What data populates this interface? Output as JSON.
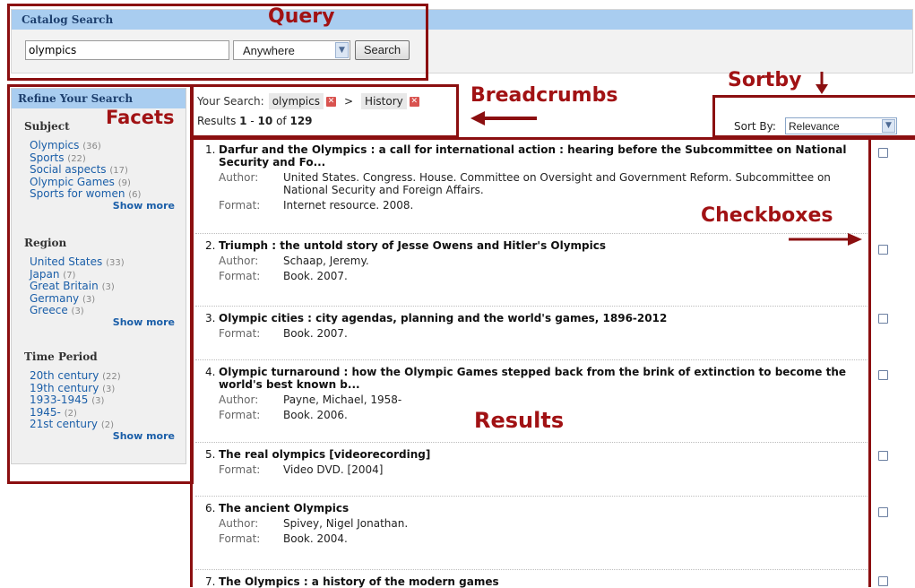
{
  "search": {
    "title": "Catalog Search",
    "query": "olympics",
    "scope": "Anywhere",
    "button": "Search"
  },
  "facets": {
    "title": "Refine Your Search",
    "groups": [
      {
        "heading": "Subject",
        "items": [
          {
            "label": "Olympics",
            "count": "(36)"
          },
          {
            "label": "Sports",
            "count": "(22)"
          },
          {
            "label": "Social aspects",
            "count": "(17)"
          },
          {
            "label": "Olympic Games",
            "count": "(9)"
          },
          {
            "label": "Sports for women",
            "count": "(6)"
          }
        ],
        "show_more": "Show more"
      },
      {
        "heading": "Region",
        "items": [
          {
            "label": "United States",
            "count": "(33)"
          },
          {
            "label": "Japan",
            "count": "(7)"
          },
          {
            "label": "Great Britain",
            "count": "(3)"
          },
          {
            "label": "Germany",
            "count": "(3)"
          },
          {
            "label": "Greece",
            "count": "(3)"
          }
        ],
        "show_more": "Show more"
      },
      {
        "heading": "Time Period",
        "items": [
          {
            "label": "20th century",
            "count": "(22)"
          },
          {
            "label": "19th century",
            "count": "(3)"
          },
          {
            "label": "1933-1945",
            "count": "(3)"
          },
          {
            "label": "1945-",
            "count": "(2)"
          },
          {
            "label": "21st century",
            "count": "(2)"
          }
        ],
        "show_more": "Show more"
      }
    ]
  },
  "breadcrumbs": {
    "label": "Your Search:",
    "crumbs": [
      "olympics",
      "History"
    ],
    "separator": ">",
    "results_prefix": "Results",
    "range_start": "1",
    "range_dash": "-",
    "range_end": "10",
    "of_text": "of",
    "total": "129"
  },
  "sort": {
    "label": "Sort By:",
    "value": "Relevance"
  },
  "results": [
    {
      "num": "1.",
      "title": "Darfur and the Olympics : a call for international action : hearing before the Subcommittee on National Security and Fo...",
      "fields": [
        {
          "label": "Author:",
          "value": "United States. Congress. House. Committee on Oversight and Government Reform. Subcommittee on National Security and Foreign Affairs."
        },
        {
          "label": "Format:",
          "value": "Internet resource. 2008."
        }
      ]
    },
    {
      "num": "2.",
      "title": "Triumph : the untold story of Jesse Owens and Hitler's Olympics",
      "fields": [
        {
          "label": "Author:",
          "value": "Schaap, Jeremy."
        },
        {
          "label": "Format:",
          "value": "Book. 2007."
        }
      ]
    },
    {
      "num": "3.",
      "title": "Olympic cities : city agendas, planning and the world's games, 1896-2012",
      "fields": [
        {
          "label": "Format:",
          "value": "Book. 2007."
        }
      ]
    },
    {
      "num": "4.",
      "title": "Olympic turnaround : how the Olympic Games stepped back from the brink of extinction to become the world's best known b...",
      "fields": [
        {
          "label": "Author:",
          "value": "Payne, Michael, 1958-"
        },
        {
          "label": "Format:",
          "value": "Book. 2006."
        }
      ]
    },
    {
      "num": "5.",
      "title": "The real olympics [videorecording]",
      "fields": [
        {
          "label": "Format:",
          "value": "Video DVD. [2004]"
        }
      ]
    },
    {
      "num": "6.",
      "title": "The ancient Olympics",
      "fields": [
        {
          "label": "Author:",
          "value": "Spivey, Nigel Jonathan."
        },
        {
          "label": "Format:",
          "value": "Book. 2004."
        }
      ]
    },
    {
      "num": "7.",
      "title": "The Olympics : a history of the modern games",
      "fields": []
    }
  ],
  "annotations": {
    "query": "Query",
    "facets": "Facets",
    "breadcrumbs": "Breadcrumbs",
    "sortby": "Sortby",
    "checkboxes": "Checkboxes",
    "results": "Results",
    "color": "#8b0f10"
  }
}
